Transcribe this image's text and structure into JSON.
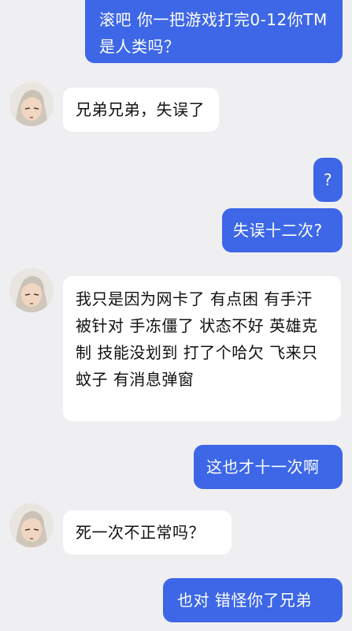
{
  "conversation": {
    "messages": [
      {
        "side": "out",
        "text": "滚吧  你一把游戏打完0-12你TM是人类吗？"
      },
      {
        "side": "in",
        "text": "兄弟兄弟，失误了"
      },
      {
        "side": "out",
        "text": "?"
      },
      {
        "side": "out",
        "text": "失误十二次?"
      },
      {
        "side": "in",
        "text": "我只是因为网卡了 有点困  有手汗 被针对 手冻僵了 状态不好 英雄克制 技能没划到 打了个哈欠 飞来只蚊子  有消息弹窗"
      },
      {
        "side": "out",
        "text": "这也才十一次啊"
      },
      {
        "side": "in",
        "text": "死一次不正常吗？"
      },
      {
        "side": "out",
        "text": "也对  错怪你了兄弟"
      }
    ]
  },
  "avatar": {
    "icon": "anime-character-avatar-icon"
  },
  "colors": {
    "background": "#efeff1",
    "outgoing_bubble": "#3d67e6",
    "incoming_bubble": "#ffffff"
  }
}
